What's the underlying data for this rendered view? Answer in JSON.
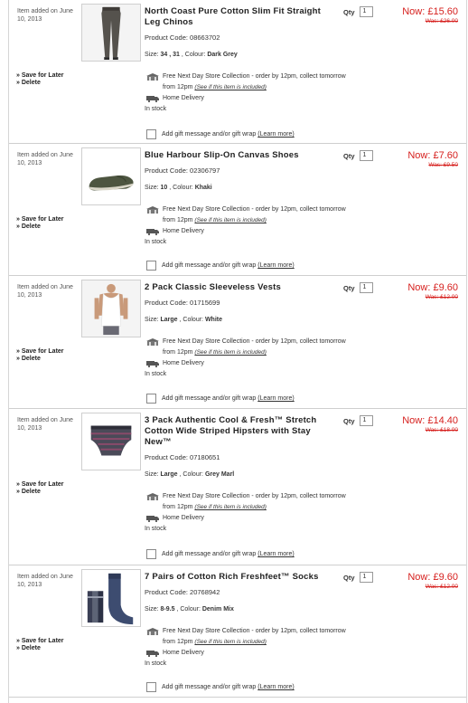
{
  "labels": {
    "save_for_later": "» Save for Later",
    "delete": "» Delete",
    "qty": "Qty",
    "size": "Size:",
    "colour": ", Colour:",
    "next_day": "Free Next Day Store Collection - order by 12pm, collect tomorrow",
    "from_12pm": "from 12pm",
    "see_if": "(See if this item is included)",
    "home_delivery": "Home Delivery",
    "in_stock": "In stock",
    "gift": "Add gift message and/or gift wrap",
    "learn_more": "(Learn more)"
  },
  "items": [
    {
      "added": "Item added on June 10, 2013",
      "title": "North Coast Pure Cotton Slim Fit Straight Leg Chinos",
      "code": "Product Code: 08663702",
      "size": "34 , 31",
      "colour": "Dark Grey",
      "qty": "1",
      "now": "£15.60",
      "now_label": "Now:",
      "was": "Was: £26.00",
      "image": "chinos-image"
    },
    {
      "added": "Item added on June 10, 2013",
      "title": "Blue Harbour Slip-On Canvas Shoes",
      "code": "Product Code: 02306797",
      "size": "10",
      "colour": "Khaki",
      "qty": "1",
      "now": "£7.60",
      "now_label": "Now:",
      "was": "Was: £9.50",
      "image": "shoes-image"
    },
    {
      "added": "Item added on June 10, 2013",
      "title": "2 Pack Classic Sleeveless Vests",
      "code": "Product Code: 01715699",
      "size": "Large",
      "colour": "White",
      "qty": "1",
      "now": "£9.60",
      "now_label": "Now:",
      "was": "Was: £12.00",
      "image": "vests-image"
    },
    {
      "added": "Item added on June 10, 2013",
      "title": "3 Pack Authentic Cool & Fresh™ Stretch Cotton Wide Striped Hipsters with Stay New™",
      "code": "Product Code: 07180651",
      "size": "Large",
      "colour": "Grey Marl",
      "qty": "1",
      "now": "£14.40",
      "now_label": "Now:",
      "was": "Was: £18.00",
      "image": "hipsters-image"
    },
    {
      "added": "Item added on June 10, 2013",
      "title": "7 Pairs of Cotton Rich Freshfeet™ Socks",
      "code": "Product Code: 20768942",
      "size": "8-9.5",
      "colour": "Denim Mix",
      "qty": "1",
      "now": "£9.60",
      "now_label": "Now:",
      "was": "Was: £12.00",
      "image": "socks-image"
    }
  ],
  "colors": {
    "price_red": "#d6201e",
    "border": "#cfcfcf"
  }
}
